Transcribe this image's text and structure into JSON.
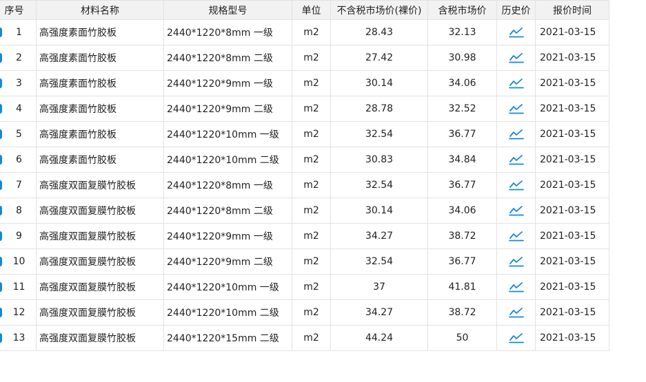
{
  "columns": {
    "index": "序号",
    "name": "材料名称",
    "spec": "规格型号",
    "unit": "单位",
    "price_excl_tax": "不含税市场价(裸价)",
    "price_incl_tax": "含税市场价",
    "history": "历史价",
    "date": "报价时间"
  },
  "accent_color": "#1588d8",
  "history_icon": "line-chart-icon",
  "rows": [
    {
      "index": "1",
      "name": "高强度素面竹胶板",
      "spec": "2440*1220*8mm 一级",
      "unit": "m2",
      "excl": "28.43",
      "incl": "32.13",
      "date": "2021-03-15"
    },
    {
      "index": "2",
      "name": "高强度素面竹胶板",
      "spec": "2440*1220*8mm 二级",
      "unit": "m2",
      "excl": "27.42",
      "incl": "30.98",
      "date": "2021-03-15"
    },
    {
      "index": "3",
      "name": "高强度素面竹胶板",
      "spec": "2440*1220*9mm 一级",
      "unit": "m2",
      "excl": "30.14",
      "incl": "34.06",
      "date": "2021-03-15"
    },
    {
      "index": "4",
      "name": "高强度素面竹胶板",
      "spec": "2440*1220*9mm 二级",
      "unit": "m2",
      "excl": "28.78",
      "incl": "32.52",
      "date": "2021-03-15"
    },
    {
      "index": "5",
      "name": "高强度素面竹胶板",
      "spec": "2440*1220*10mm 一级",
      "unit": "m2",
      "excl": "32.54",
      "incl": "36.77",
      "date": "2021-03-15"
    },
    {
      "index": "6",
      "name": "高强度素面竹胶板",
      "spec": "2440*1220*10mm 二级",
      "unit": "m2",
      "excl": "30.83",
      "incl": "34.84",
      "date": "2021-03-15"
    },
    {
      "index": "7",
      "name": "高强度双面复膜竹胶板",
      "spec": "2440*1220*8mm 一级",
      "unit": "m2",
      "excl": "32.54",
      "incl": "36.77",
      "date": "2021-03-15"
    },
    {
      "index": "8",
      "name": "高强度双面复膜竹胶板",
      "spec": "2440*1220*8mm 二级",
      "unit": "m2",
      "excl": "30.14",
      "incl": "34.06",
      "date": "2021-03-15"
    },
    {
      "index": "9",
      "name": "高强度双面复膜竹胶板",
      "spec": "2440*1220*9mm 一级",
      "unit": "m2",
      "excl": "34.27",
      "incl": "38.72",
      "date": "2021-03-15"
    },
    {
      "index": "10",
      "name": "高强度双面复膜竹胶板",
      "spec": "2440*1220*9mm 二级",
      "unit": "m2",
      "excl": "32.54",
      "incl": "36.77",
      "date": "2021-03-15"
    },
    {
      "index": "11",
      "name": "高强度双面复膜竹胶板",
      "spec": "2440*1220*10mm 一级",
      "unit": "m2",
      "excl": "37",
      "incl": "41.81",
      "date": "2021-03-15"
    },
    {
      "index": "12",
      "name": "高强度双面复膜竹胶板",
      "spec": "2440*1220*10mm 二级",
      "unit": "m2",
      "excl": "34.27",
      "incl": "38.72",
      "date": "2021-03-15"
    },
    {
      "index": "13",
      "name": "高强度双面复膜竹胶板",
      "spec": "2440*1220*15mm 二级",
      "unit": "m2",
      "excl": "44.24",
      "incl": "50",
      "date": "2021-03-15"
    }
  ]
}
